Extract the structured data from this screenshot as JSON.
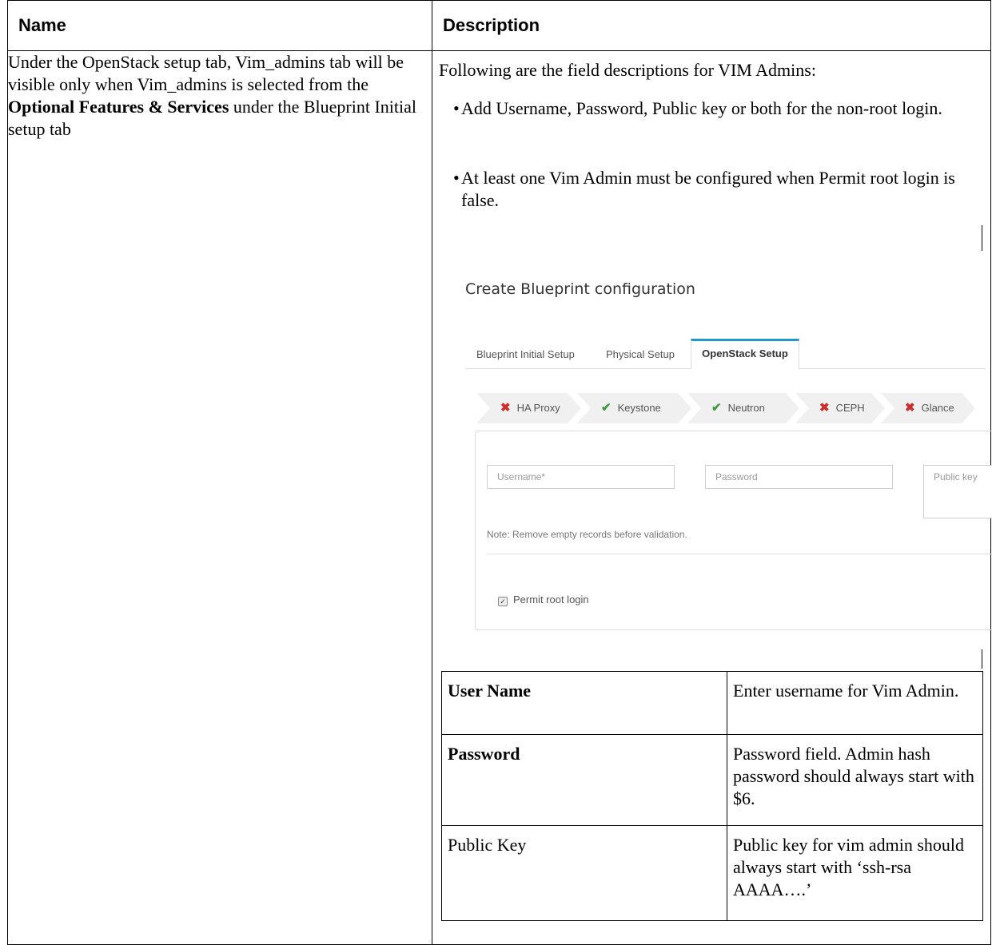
{
  "table": {
    "header_name": "Name",
    "header_description": "Description"
  },
  "name_cell": {
    "text_before": "Under the OpenStack setup tab, Vim_admins tab will be visible only when Vim_admins is selected from the ",
    "bold": "Optional Features & Services",
    "text_after": " under the Blueprint Initial setup tab"
  },
  "description": {
    "intro": "Following are the field descriptions for VIM Admins:",
    "bullets": [
      "Add Username, Password, Public key or both for the non-root login.",
      "At least one Vim Admin must be configured when Permit root login is false."
    ]
  },
  "screenshot": {
    "title": "Create Blueprint configuration",
    "tabs": [
      "Blueprint Initial Setup",
      "Physical Setup",
      "OpenStack Setup"
    ],
    "active_tab": "OpenStack Setup",
    "steps": [
      {
        "label": "HA Proxy",
        "status": "error",
        "icon": "x-mark-icon"
      },
      {
        "label": "Keystone",
        "status": "ok",
        "icon": "check-mark-icon"
      },
      {
        "label": "Neutron",
        "status": "ok",
        "icon": "check-mark-icon"
      },
      {
        "label": "CEPH",
        "status": "error",
        "icon": "x-mark-icon"
      },
      {
        "label": "Glance",
        "status": "error",
        "icon": "x-mark-icon"
      }
    ],
    "fields": {
      "username_placeholder": "Username*",
      "password_placeholder": "Password",
      "public_key_placeholder": "Public key"
    },
    "note": "Note: Remove empty records before validation.",
    "permit_root_login": {
      "label": "Permit root login",
      "checked": true
    },
    "colors": {
      "accent": "#1f97c9",
      "error": "#c9302c",
      "ok": "#3f9b3f"
    }
  },
  "fields_table": [
    {
      "field": "User Name",
      "bold": true,
      "description": "Enter username for Vim Admin."
    },
    {
      "field": "Password",
      "bold": true,
      "description": "Password field. Admin hash password should always start with $6."
    },
    {
      "field": "Public Key",
      "bold": false,
      "description": "Public key for vim admin should always start with ‘ssh-rsa AAAA….’"
    }
  ]
}
